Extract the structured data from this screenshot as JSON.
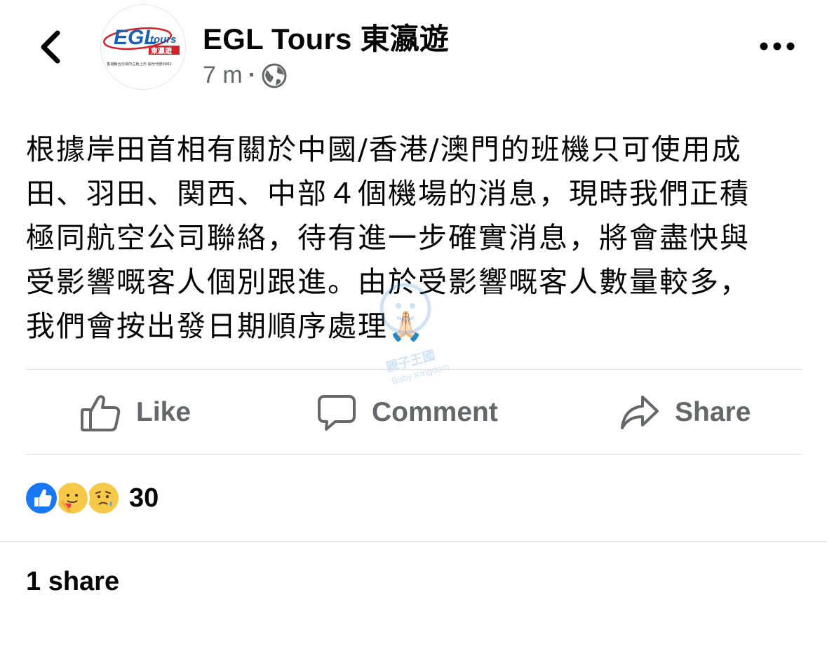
{
  "post": {
    "page_name": "EGL Tours 東瀛遊",
    "time": "7 m",
    "separator": "·",
    "privacy_icon": "globe-icon",
    "avatar": {
      "logo_main": "EGL",
      "logo_sub": "tours",
      "logo_chinese": "東瀛遊",
      "logo_caption": "香港聯合交易所主板上市 股份代號6882"
    },
    "text_lines": [
      "根據岸田首相有關於中國/香港/澳門的班機只可使用成",
      "田、羽田、関西、中部４個機場的消息，現時我們正積",
      "極同航空公司聯絡，待有進一步確實消息，將會盡快與",
      "受影響嘅客人個別跟進。由於受影響嘅客人數量較多，",
      "我們會按出發日期順序處理🙏🏻"
    ],
    "watermark": {
      "text": "親子王國",
      "text_en": "Baby Kingdom"
    }
  },
  "actions": {
    "like_label": "Like",
    "comment_label": "Comment",
    "share_label": "Share"
  },
  "reactions": {
    "types": [
      "like-icon",
      "care-icon",
      "sad-icon"
    ],
    "count": "30"
  },
  "shares": {
    "label": "1 share"
  },
  "colors": {
    "text": "#050505",
    "secondary": "#65676b",
    "like_blue": "#1877f2",
    "divider": "#dadde1",
    "brand_red": "#d2232a"
  }
}
